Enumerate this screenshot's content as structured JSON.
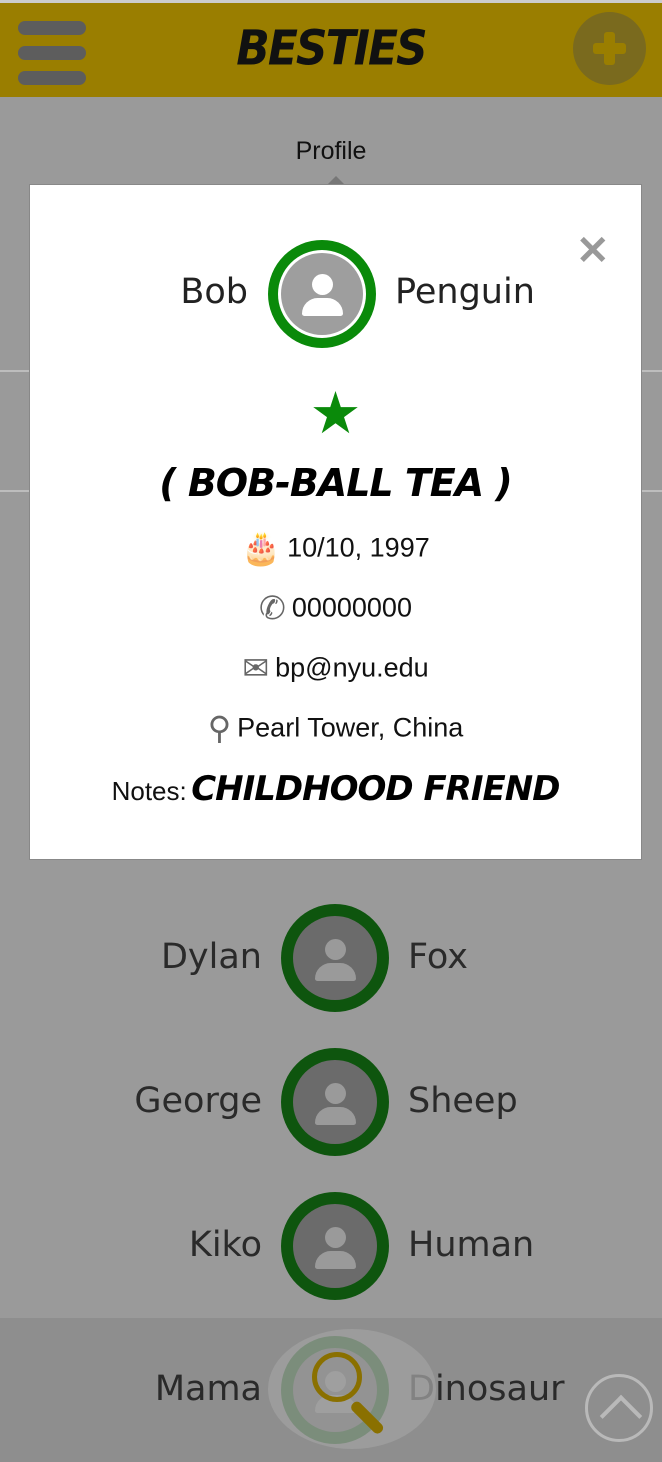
{
  "header": {
    "title": "BESTIES"
  },
  "profile_tab": {
    "label": "Profile"
  },
  "friends": [
    {
      "first": "Dylan",
      "last": "Fox"
    },
    {
      "first": "George",
      "last": "Sheep"
    },
    {
      "first": "Kiko",
      "last": "Human"
    },
    {
      "first": "Mama",
      "last": "Dinosaur"
    }
  ],
  "profile": {
    "first": "Bob",
    "last": "Penguin",
    "nickname": "( BOB-BALL TEA )",
    "birthday": "10/10, 1997",
    "phone": "00000000",
    "email": "bp@nyu.edu",
    "location": "Pearl Tower, China",
    "notes_label": "Notes:",
    "notes": "CHILDHOOD FRIEND"
  },
  "icons": {
    "menu": "hamburger-icon",
    "add": "plus-icon",
    "close": "close-icon",
    "favorite": "star-icon",
    "birthday": "cake-icon",
    "phone": "phone-icon",
    "email": "envelope-icon",
    "location": "map-pin-icon",
    "search": "search-icon",
    "scroll_top": "chevron-up-icon"
  },
  "colors": {
    "header_bg": "#9a7e00",
    "accent_green": "#0a8a0a"
  }
}
